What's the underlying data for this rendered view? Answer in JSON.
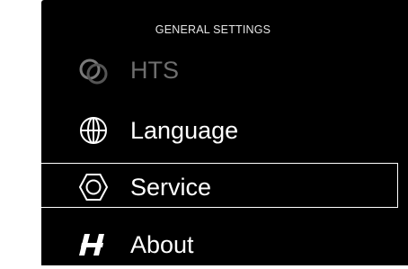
{
  "header": {
    "title": "GENERAL SETTINGS"
  },
  "menu": {
    "items": [
      {
        "label": "HTS",
        "icon": "hts-icon",
        "enabled": false
      },
      {
        "label": "Language",
        "icon": "globe-icon",
        "enabled": true
      },
      {
        "label": "Service",
        "icon": "hexagon-nut-icon",
        "enabled": true,
        "selected": true
      },
      {
        "label": "About",
        "icon": "hasselblad-h-icon",
        "enabled": true
      }
    ]
  },
  "colors": {
    "background": "#000000",
    "text": "#ffffff",
    "disabled_text": "#6e6e6e",
    "selection_border": "#ffffff"
  }
}
